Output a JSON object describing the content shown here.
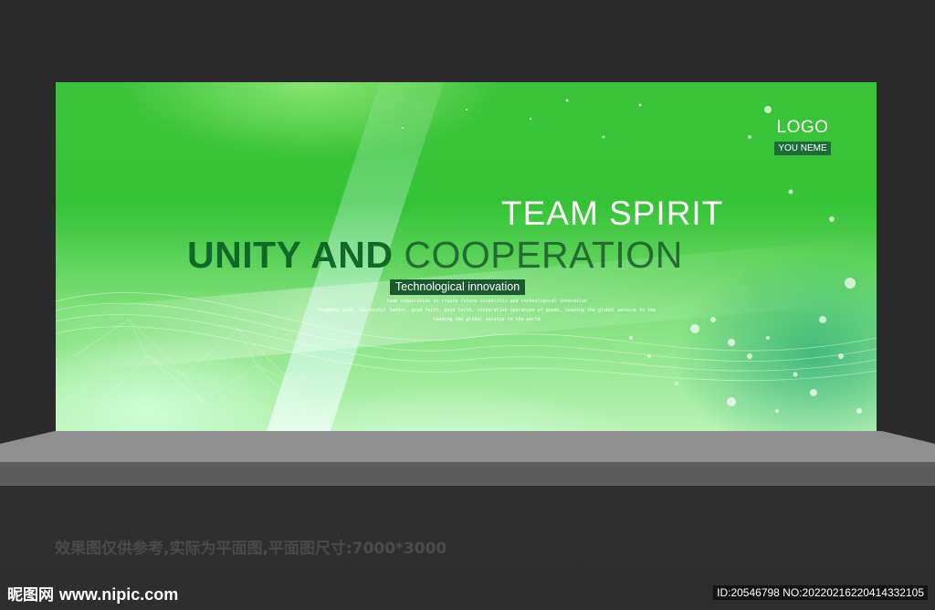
{
  "banner": {
    "logo": "LOGO",
    "logo_sub": "YOU NEME",
    "headline_1": "TEAM SPIRIT",
    "headline_2_bold": "UNITY AND",
    "headline_2_light": "COOPERATION",
    "subtitle": "Technological innovation",
    "body_lines": [
      "Team cooperation to create future scientific and technological innovation",
      "Yongdeng peak, successful ladder, good faith, good faith, cooperative operation of goods, leading the global service to the",
      "leading the global service to the world"
    ],
    "colors": {
      "primary_green": "#35c336",
      "dark_green": "#0f6a2a",
      "label_bg": "#1a5a2e"
    }
  },
  "caption": "效果图仅供参考,实际为平面图,平面图尺寸:7000*3000",
  "watermark": {
    "site_cn": "昵图网",
    "site_url": "www.nipic.com",
    "id_text": "ID:20546798 NO:20220216220414332105"
  }
}
